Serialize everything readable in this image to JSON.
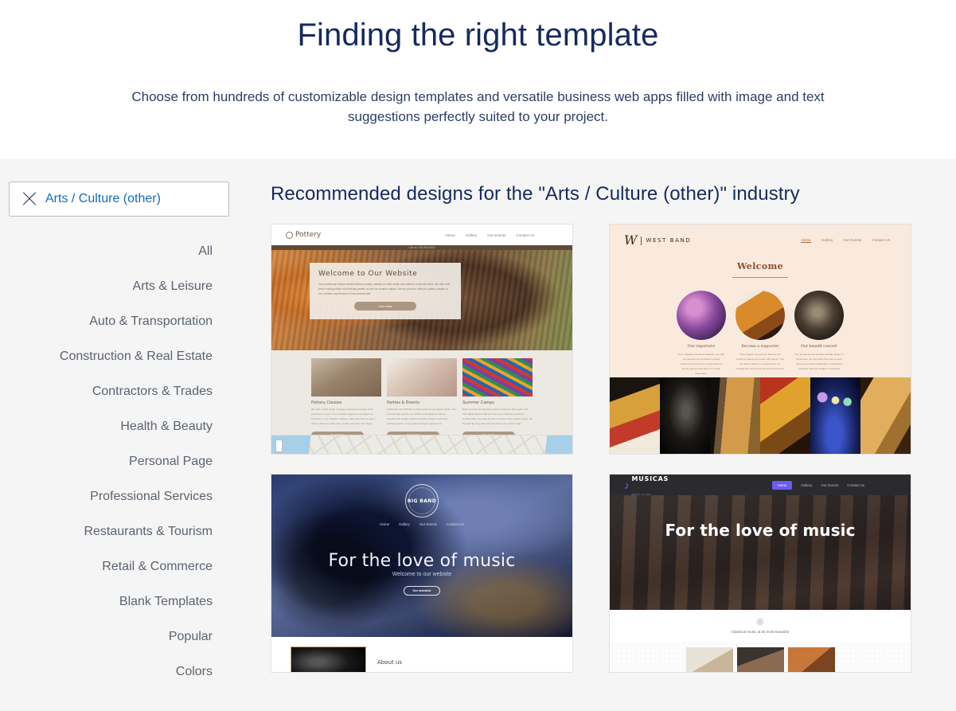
{
  "header": {
    "title": "Finding the right template",
    "subtitle": "Choose from hundreds of customizable design templates and versatile business web apps filled with image and text suggestions perfectly suited to your project."
  },
  "sidebar": {
    "filter_chip": {
      "label": "Arts / Culture (other)",
      "remove_icon": "close-x-icon",
      "text_color": "#1669bb"
    },
    "categories": [
      {
        "label": "All"
      },
      {
        "label": "Arts & Leisure"
      },
      {
        "label": "Auto & Transportation"
      },
      {
        "label": "Construction & Real Estate"
      },
      {
        "label": "Contractors & Trades"
      },
      {
        "label": "Health & Beauty"
      },
      {
        "label": "Personal Page"
      },
      {
        "label": "Professional Services"
      },
      {
        "label": "Restaurants & Tourism"
      },
      {
        "label": "Retail & Commerce"
      },
      {
        "label": "Blank Templates"
      },
      {
        "label": "Popular"
      },
      {
        "label": "Colors"
      }
    ]
  },
  "main": {
    "title": "Recommended designs for the \"Arts / Culture (other)\" industry",
    "templates": [
      {
        "id": "pottery",
        "brand": "Pottery",
        "logo_icon": "pottery-ring-icon",
        "nav": [
          "Home",
          "Gallery",
          "Our Events",
          "Contact Us"
        ],
        "topbar": "Call us: 354-560-5634",
        "hero_heading": "Welcome to Our Website",
        "hero_text": "Our community location studio features pottery classes for both adults and children of all skill levels. We also host fresh exciting offsite and birthday parties as well as summer camps. We are proud to offer fun pottery classes in fun, creative experiences in that relaxed cafe.",
        "hero_button": "Learn More",
        "cards": [
          {
            "title": "Pottery Classes",
            "text": "We offer a wide range of pottery classes for people of all experience levels, from complete beginners to advanced students. In our children's classes, kids learn how to use a pottery wheel to make cups, bowls, and other fun things.",
            "button": "View Details"
          },
          {
            "title": "Parties & Events",
            "text": "Celebrate your birthday or other event at our pottery studio. We host birthday parties for children and adults as well as bachelorette parties, bridal and baby showers, and team building events. Your guests will have a great time!",
            "button": "View Details"
          },
          {
            "title": "Summer Camps",
            "text": "Each summer we host five pottery camps for kids aged 7-14. Our highly trained staff will teach your child the basics of working with clay such as how to throw on the pottery wheel. On the last day they will paint the pieces they have made.",
            "button": "More Details"
          }
        ],
        "footer_map": "location-map"
      },
      {
        "id": "west-band",
        "brand": "WEST BAND",
        "logo_icon": "wb-monogram-icon",
        "nav": [
          "Home",
          "Gallery",
          "Our Events",
          "Contact Us"
        ],
        "heading": "Welcome",
        "columns": [
          {
            "title": "Our repertoire",
            "text": "From ragtime to timeless classics, we offer our listeners an exclusive musical experience and we try to give listeners known genres that allow for a deep immersion."
          },
          {
            "title": "Become a supporter",
            "text": "Help support our work so that we can continue sharing our music with others. Your donations will go to a good cause, for example the sound and the new instruments."
          },
          {
            "title": "Our benefit concert",
            "text": "Our annual benefit concert will take place on September 16. All orders from this concert will go to a charity dedicated to supporting musically talented children in Namibia."
          }
        ],
        "gallery": "instrument-photo-strip"
      },
      {
        "id": "big-band",
        "brand": "BIG BAND",
        "logo_icon": "circular-badge-icon",
        "nav": [
          "Home",
          "Gallery",
          "Our Events",
          "Contact Us"
        ],
        "hero_heading": "For the love of music",
        "hero_sub": "Welcome to our website",
        "hero_button": "Our schedule",
        "section_title": "About us"
      },
      {
        "id": "musicas",
        "brand": "MUSICAS",
        "brand_sub": "MUSIC IS LIFE",
        "logo_icon": "music-note-icon",
        "nav": [
          "Home",
          "Gallery",
          "Our Events",
          "Contact Us"
        ],
        "active_nav": "Home",
        "accent_color": "#6b5cf0",
        "hero_heading": "For the love of music",
        "tagline": "Classical music at its most beautiful",
        "tagline_icon": "flourish-icon"
      }
    ]
  }
}
